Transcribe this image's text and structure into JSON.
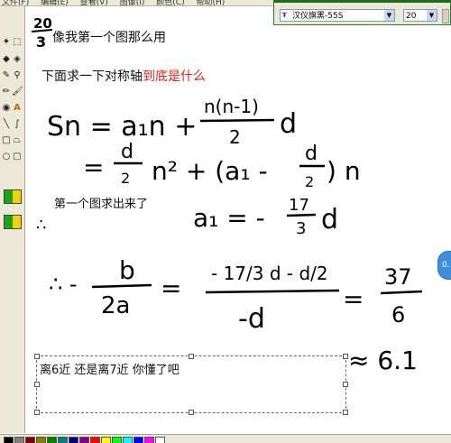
{
  "menu": {
    "items": [
      "文件(F)",
      "编辑(E)",
      "查看(V)",
      "图像(I)",
      "颜色(C)",
      "帮助(H)"
    ]
  },
  "font_toolbar": {
    "font_name": "汉仪旗黑-55S",
    "font_size": "20"
  },
  "canvas": {
    "line1": "像我第一个图那么用",
    "line2_black": "下面求一下对称轴",
    "line2_red": "到底是什么",
    "line3": "第一个图求出来了",
    "line4": "离6近   还是离7近      你懂了吧",
    "side_button": "0.",
    "handwriting": {
      "frac_top": "20",
      "frac_bot": "3",
      "sn_formula_lhs": "Sn = a₁n +",
      "sn_frac_num": "n(n-1)",
      "sn_frac_den": "2",
      "sn_d": "d",
      "eq2_start": "=",
      "eq2_num": "d",
      "eq2_den": "2",
      "eq2_mid": "n² + (a₁ -",
      "eq2_num2": "d",
      "eq2_den2": "2",
      "eq2_end": ") n",
      "a1_lhs": "a₁ = -",
      "a1_num": "17",
      "a1_den": "3",
      "a1_d": "d",
      "therefore": "∴",
      "therefore2": "∴ -",
      "b_num": "b",
      "b_den": "2a",
      "eq": "=",
      "big_num": "- 17/3 d - d/2",
      "big_den": "-d",
      "eq3": "=",
      "res_num": "37",
      "res_den": "6",
      "approx": "≈ 6.1"
    }
  },
  "colors": {
    "accent_red": "#e0211c",
    "toolbar_green": "#1d6b1d"
  }
}
